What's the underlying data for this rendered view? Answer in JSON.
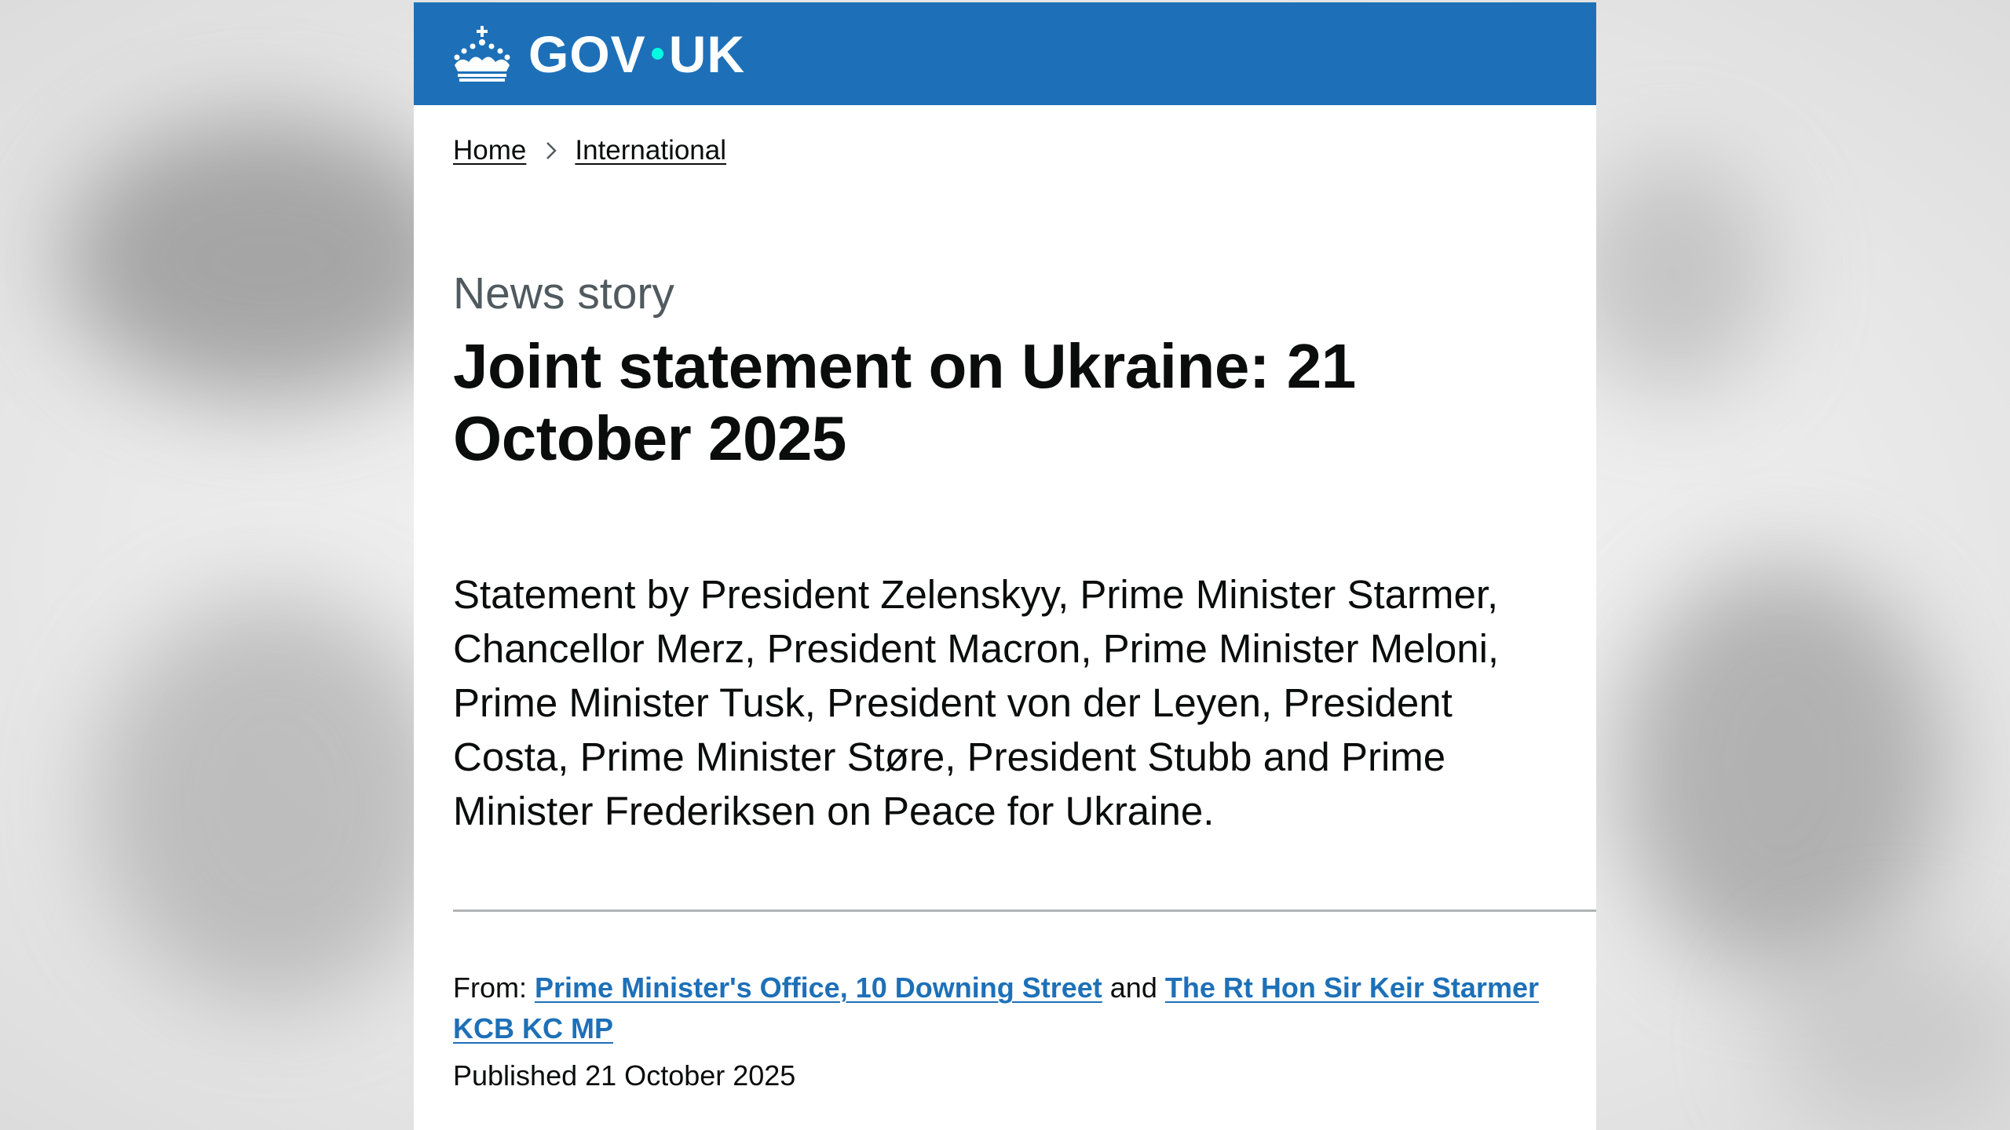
{
  "header": {
    "logo_text_left": "GOV",
    "logo_text_right": "UK"
  },
  "breadcrumb": {
    "items": [
      {
        "label": "Home"
      },
      {
        "label": "International"
      }
    ]
  },
  "article": {
    "caption": "News story",
    "title": "Joint statement on Ukraine: 21 October 2025",
    "lead": "Statement by President Zelenskyy, Prime Minister Starmer, Chancellor Merz, President Macron, Prime Minister Meloni, Prime Minister Tusk,  President von der Leyen, President Costa, Prime Minister Støre, President Stubb and Prime Minister Frederiksen on Peace for Ukraine."
  },
  "metadata": {
    "from_label": "From:",
    "from_links": [
      "Prime Minister's Office, 10 Downing Street",
      "The Rt Hon Sir Keir Starmer KCB KC MP"
    ],
    "conjunction": "and",
    "published_label": "Published",
    "published_date": "21 October 2025"
  },
  "colors": {
    "header_blue": "#1d70b8",
    "link_blue": "#1d70b8",
    "logo_dot": "#00ffe0",
    "text": "#0b0c0c",
    "secondary_text": "#505a5f"
  }
}
